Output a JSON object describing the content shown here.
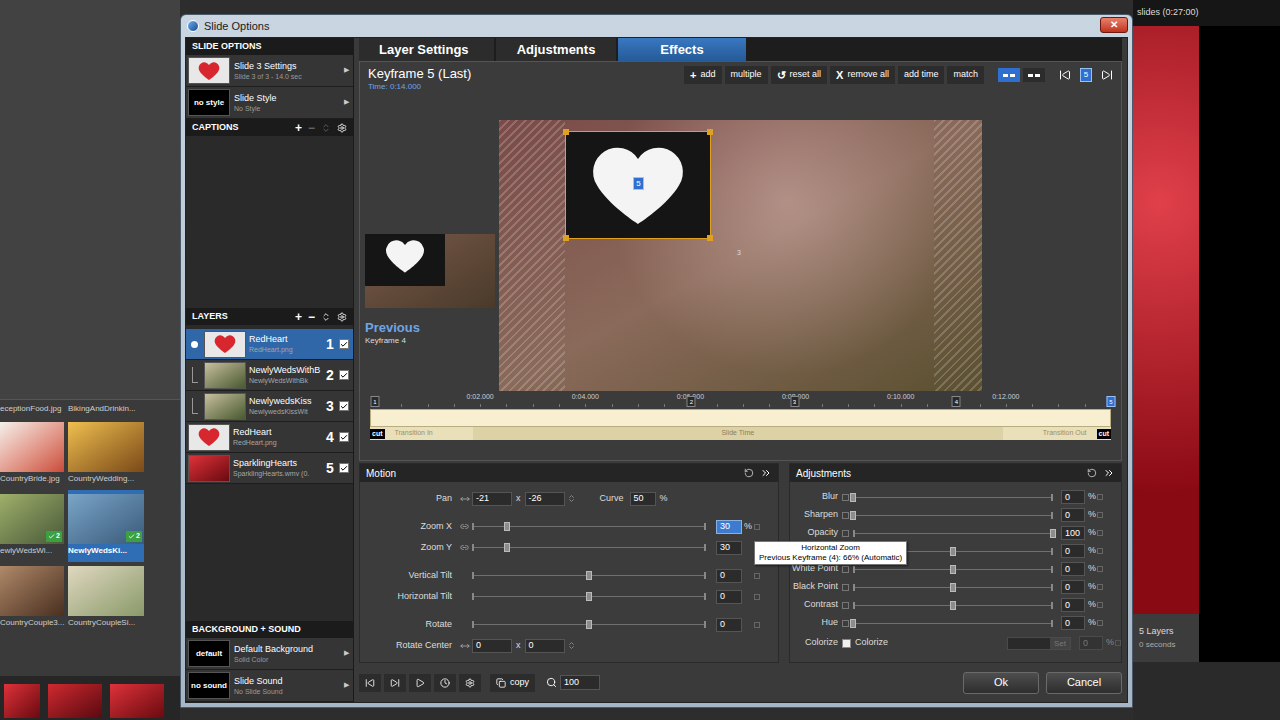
{
  "window": {
    "title": "Slide Options",
    "close": "✕"
  },
  "app": {
    "slides_summary": "slides (0:27:00)",
    "layers_count": "5 Layers",
    "duration": "0 seconds",
    "files": [
      {
        "name": "eceptionFood.jpg",
        "kind": "cut",
        "selected": false
      },
      {
        "name": "BikingAndDrinkin...",
        "kind": "cut",
        "selected": false
      },
      {
        "name": "CountryBride.jpg",
        "kind": "full",
        "selected": false
      },
      {
        "name": "CountryWedding...",
        "kind": "full",
        "selected": false
      },
      {
        "name": "ewlyWedsWi...",
        "kind": "full",
        "selected": false,
        "badge": "2"
      },
      {
        "name": "NewlyWedsKi...",
        "kind": "full",
        "selected": true,
        "badge": "2"
      },
      {
        "name": "CountryCouple3...",
        "kind": "full",
        "selected": false
      },
      {
        "name": "CountryCoupleSi...",
        "kind": "full",
        "selected": false
      }
    ]
  },
  "sidebar": {
    "slide_options": {
      "header": "SLIDE OPTIONS",
      "items": [
        {
          "title": "Slide 3 Settings",
          "subtitle": "Slide 3 of 3 - 14.0 sec",
          "thumb": "heart",
          "arrow": "▶"
        },
        {
          "title": "Slide Style",
          "subtitle": "No Style",
          "thumb_text": "no style",
          "arrow": "▶"
        }
      ]
    },
    "captions": {
      "header": "CAPTIONS",
      "add": "+",
      "remove": "−",
      "remove_disabled": true,
      "reorder_disabled": true
    },
    "layers": {
      "header": "LAYERS",
      "add": "+",
      "remove": "−",
      "items": [
        {
          "name": "RedHeart",
          "file": "RedHeart.png",
          "number": "1",
          "selected": true,
          "checked": true,
          "indent": true,
          "is_mask": true,
          "thumb": "heart"
        },
        {
          "name": "NewlyWedsWithB",
          "file": "NewlyWedsWithBk",
          "number": "2",
          "selected": false,
          "checked": true,
          "indent": true,
          "is_mask": false,
          "thumb": "photo"
        },
        {
          "name": "NewlywedsKiss",
          "file": "NewlywedsKissWit",
          "number": "3",
          "selected": false,
          "checked": true,
          "indent": true,
          "is_mask": false,
          "thumb": "photo"
        },
        {
          "name": "RedHeart",
          "file": "RedHeart.png",
          "number": "4",
          "selected": false,
          "checked": true,
          "indent": false,
          "is_mask": false,
          "thumb": "heart"
        },
        {
          "name": "SparklingHearts",
          "file": "SparklingHearts.wmv (0.",
          "number": "5",
          "selected": false,
          "checked": true,
          "indent": false,
          "is_mask": false,
          "thumb": "sparkle"
        }
      ]
    },
    "background_sound": {
      "header": "BACKGROUND + SOUND",
      "items": [
        {
          "title": "Default Background",
          "subtitle": "Solid Color",
          "thumb_text": "default",
          "arrow": "▶"
        },
        {
          "title": "Slide Sound",
          "subtitle": "No Slide Sound",
          "thumb_text": "no sound",
          "arrow": "▶"
        }
      ]
    }
  },
  "tabs": [
    {
      "label": "Layer Settings",
      "selected": false
    },
    {
      "label": "Adjustments",
      "selected": false
    },
    {
      "label": "Effects",
      "selected": true
    }
  ],
  "keyframe": {
    "title": "Keyframe 5 (Last)",
    "time": "Time: 0:14.000",
    "current": "5"
  },
  "toolbar": [
    {
      "icon": "+",
      "label": "add"
    },
    {
      "icon": "",
      "label": "multiple"
    },
    {
      "icon": "↺",
      "label": "reset all"
    },
    {
      "icon": "X",
      "label": "remove all"
    },
    {
      "icon": "",
      "label": "add time"
    },
    {
      "icon": "",
      "label": "match"
    }
  ],
  "view_toggles": [
    {
      "selected": true
    },
    {
      "selected": false
    }
  ],
  "preview": {
    "previous_label": "Previous",
    "previous_keyframe": "Keyframe 4",
    "markers": [
      {
        "label": "5",
        "selected": true
      },
      {
        "label": "3",
        "selected": false
      }
    ]
  },
  "timeline": {
    "ticks": [
      "0:02.000",
      "0:04.000",
      "0:06.000",
      "0:08.000",
      "0:10.000",
      "0:12.000"
    ],
    "keyframes": [
      {
        "label": "1",
        "level": 0,
        "selected": false
      },
      {
        "label": "2",
        "level": 0.43,
        "selected": false
      },
      {
        "label": "3",
        "level": 0.57,
        "selected": false
      },
      {
        "label": "4",
        "level": 0.79,
        "selected": false
      },
      {
        "label": "5",
        "level": 1,
        "selected": true
      }
    ],
    "cut_in": "cut",
    "cut_out": "cut",
    "transition_in": "Transition In",
    "slide_time": "Slide Time",
    "transition_out": "Transition Out"
  },
  "motion": {
    "header": "Motion",
    "pan": {
      "label": "Pan",
      "x": "-21",
      "sep": "x",
      "y": "-26"
    },
    "curve": {
      "label": "Curve",
      "value": "50",
      "unit": "%"
    },
    "sliders": [
      {
        "label": "Zoom X",
        "value": "30",
        "unit": "%",
        "level": 0.15,
        "editing": true
      },
      {
        "label": "Zoom Y",
        "value": "30",
        "level": 0.15,
        "editing": false
      },
      {
        "label": "Vertical Tilt",
        "value": "0",
        "level": 0.5,
        "editing": false
      },
      {
        "label": "Horizontal Tilt",
        "value": "0",
        "level": 0.5,
        "editing": false
      },
      {
        "label": "Rotate",
        "value": "0",
        "level": 0.5,
        "editing": false
      }
    ],
    "rotate_center": {
      "label": "Rotate Center",
      "x": "0",
      "sep": "x",
      "y": "0"
    }
  },
  "tooltip": {
    "title": "Horizontal Zoom",
    "text": "Previous Keyframe (4): 66% (Automatic)"
  },
  "adjustments": {
    "header": "Adjustments",
    "rows": [
      {
        "label": "Blur",
        "value": "0",
        "unit": "%",
        "level": 0
      },
      {
        "label": "Sharpen",
        "value": "0",
        "unit": "%",
        "level": 0
      },
      {
        "label": "Opacity",
        "value": "100",
        "unit": "%",
        "level": 1
      },
      {
        "label": "",
        "value": "0",
        "unit": "%",
        "level": 0.5
      },
      {
        "label": "White Point",
        "value": "0",
        "unit": "%",
        "level": 0.5
      },
      {
        "label": "Black Point",
        "value": "0",
        "unit": "%",
        "level": 0.5
      },
      {
        "label": "Contrast",
        "value": "0",
        "unit": "%",
        "level": 0.5
      },
      {
        "label": "Hue",
        "value": "0",
        "unit": "%",
        "level": 0
      }
    ],
    "colorize": {
      "label": "Colorize",
      "checkbox_label": "Colorize",
      "checked": false,
      "button": "Set",
      "value": "0",
      "unit": "%",
      "disabled": true
    }
  },
  "bottom": {
    "copy": "copy",
    "zoom": "100"
  },
  "buttons": [
    "Ok",
    "Cancel"
  ]
}
